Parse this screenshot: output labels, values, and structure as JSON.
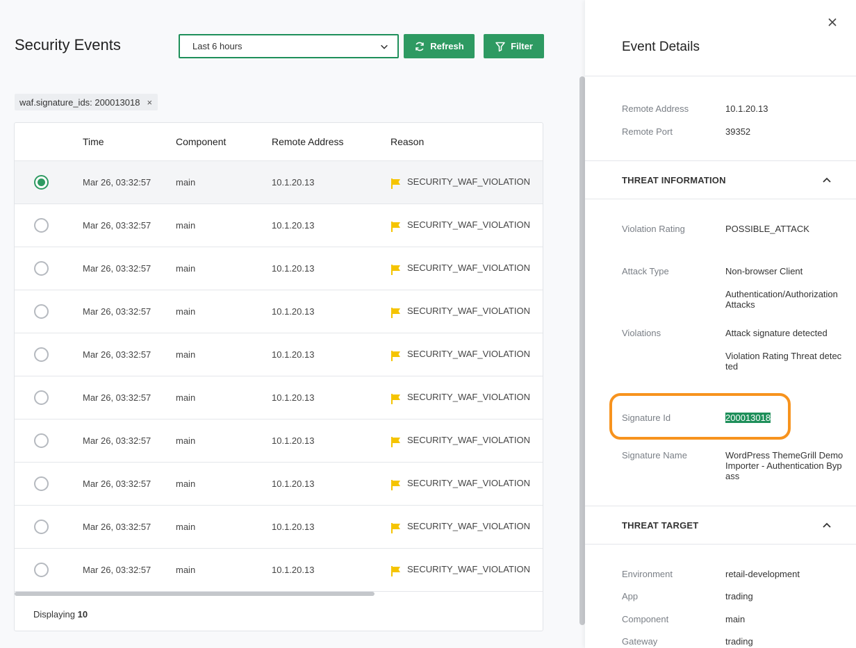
{
  "header": {
    "title": "Security Events",
    "range": "Last 6 hours",
    "refresh_label": "Refresh",
    "filter_label": "Filter"
  },
  "filter_chip": {
    "label": "waf.signature_ids: 200013018",
    "remove": "×"
  },
  "table": {
    "columns": [
      "Time",
      "Component",
      "Remote Address",
      "Reason"
    ],
    "rows": [
      {
        "time": "Mar 26, 03:32:57",
        "component": "main",
        "address": "10.1.20.13",
        "reason": "SECURITY_WAF_VIOLATION"
      },
      {
        "time": "Mar 26, 03:32:57",
        "component": "main",
        "address": "10.1.20.13",
        "reason": "SECURITY_WAF_VIOLATION"
      },
      {
        "time": "Mar 26, 03:32:57",
        "component": "main",
        "address": "10.1.20.13",
        "reason": "SECURITY_WAF_VIOLATION"
      },
      {
        "time": "Mar 26, 03:32:57",
        "component": "main",
        "address": "10.1.20.13",
        "reason": "SECURITY_WAF_VIOLATION"
      },
      {
        "time": "Mar 26, 03:32:57",
        "component": "main",
        "address": "10.1.20.13",
        "reason": "SECURITY_WAF_VIOLATION"
      },
      {
        "time": "Mar 26, 03:32:57",
        "component": "main",
        "address": "10.1.20.13",
        "reason": "SECURITY_WAF_VIOLATION"
      },
      {
        "time": "Mar 26, 03:32:57",
        "component": "main",
        "address": "10.1.20.13",
        "reason": "SECURITY_WAF_VIOLATION"
      },
      {
        "time": "Mar 26, 03:32:57",
        "component": "main",
        "address": "10.1.20.13",
        "reason": "SECURITY_WAF_VIOLATION"
      },
      {
        "time": "Mar 26, 03:32:57",
        "component": "main",
        "address": "10.1.20.13",
        "reason": "SECURITY_WAF_VIOLATION"
      },
      {
        "time": "Mar 26, 03:32:57",
        "component": "main",
        "address": "10.1.20.13",
        "reason": "SECURITY_WAF_VIOLATION"
      }
    ],
    "footer_label": "Displaying",
    "footer_count": "10"
  },
  "details": {
    "title": "Event Details",
    "remote_address_label": "Remote Address",
    "remote_address": "10.1.20.13",
    "remote_port_label": "Remote Port",
    "remote_port": "39352",
    "threat_info_title": "THREAT INFORMATION",
    "violation_rating_label": "Violation Rating",
    "violation_rating": "POSSIBLE_ATTACK",
    "attack_type_label": "Attack Type",
    "attack_type_1": "Non-browser Client",
    "attack_type_2": "Authentication/Authorization Attacks",
    "violations_label": "Violations",
    "violation_1": "Attack signature detected",
    "violation_2": "Violation Rating Threat detected",
    "signature_id_label": "Signature Id",
    "signature_id": "200013018",
    "signature_name_label": "Signature Name",
    "signature_name": "WordPress ThemeGrill Demo Importer - Authentication Bypass",
    "threat_target_title": "THREAT TARGET",
    "environment_label": "Environment",
    "environment": "retail-development",
    "app_label": "App",
    "app": "trading",
    "component_label": "Component",
    "component": "main",
    "gateway_label": "Gateway",
    "gateway": "trading"
  },
  "colors": {
    "brand_green": "#2e9a62",
    "highlight_orange": "#f7931e",
    "flag_yellow": "#f5c400"
  }
}
